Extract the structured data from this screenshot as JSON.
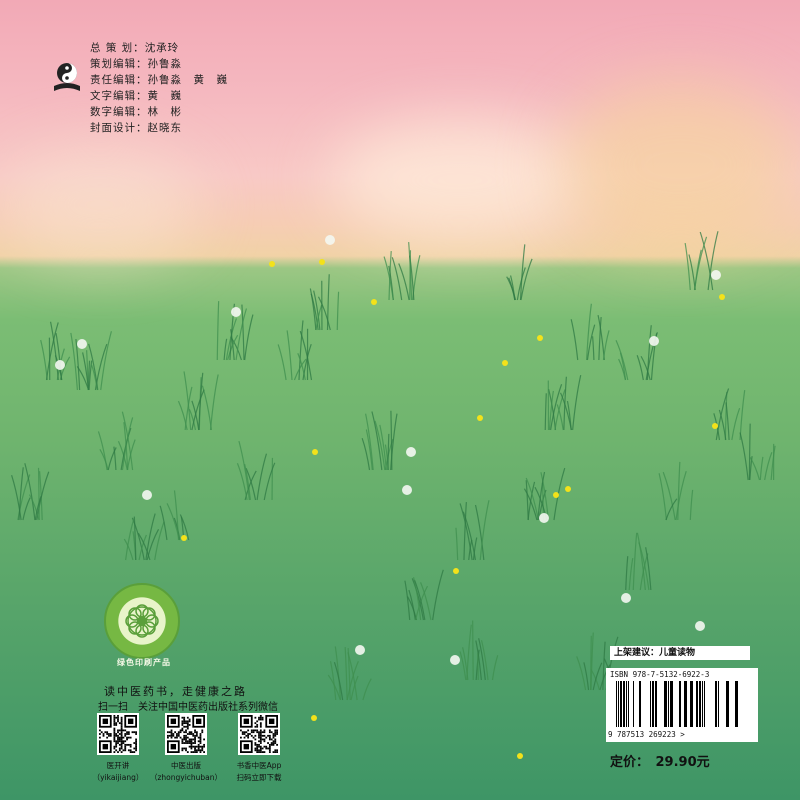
{
  "credits": [
    {
      "label": "总 策 划：",
      "value": "沈承玲"
    },
    {
      "label": "策划编辑：",
      "value": "孙鲁淼"
    },
    {
      "label": "责任编辑：",
      "value": "孙鲁淼　黄　巍"
    },
    {
      "label": "文字编辑：",
      "value": "黄　巍"
    },
    {
      "label": "数字编辑：",
      "value": "林　彬"
    },
    {
      "label": "封面设计：",
      "value": "赵晓东"
    }
  ],
  "publisher_logo": "yin-yang-book-logo",
  "green_seal": {
    "caption": "绿色印刷产品"
  },
  "slogan": "读中医药书，走健康之路",
  "follow_text": "扫一扫　关注中国中医药出版社系列微信",
  "qr_codes": [
    {
      "line1": "医开讲",
      "line2": "（yikaijiang）"
    },
    {
      "line1": "中医出版",
      "line2": "（zhongyichuban）"
    },
    {
      "line1": "书香中医App",
      "line2": "扫码立即下载"
    }
  ],
  "shelf_suggestion": "上架建议：儿童读物",
  "isbn": "ISBN 978-7-5132-6922-3",
  "barcode_digits": "9 787513 269223 >",
  "price": "定价：　29.90元",
  "colors": {
    "sky_pink": "#f2a9b6",
    "horizon_peach": "#f1d2a6",
    "grass": "#6fb46e",
    "deep_grass": "#3e9566",
    "flower_yellow": "#f3e21a"
  }
}
